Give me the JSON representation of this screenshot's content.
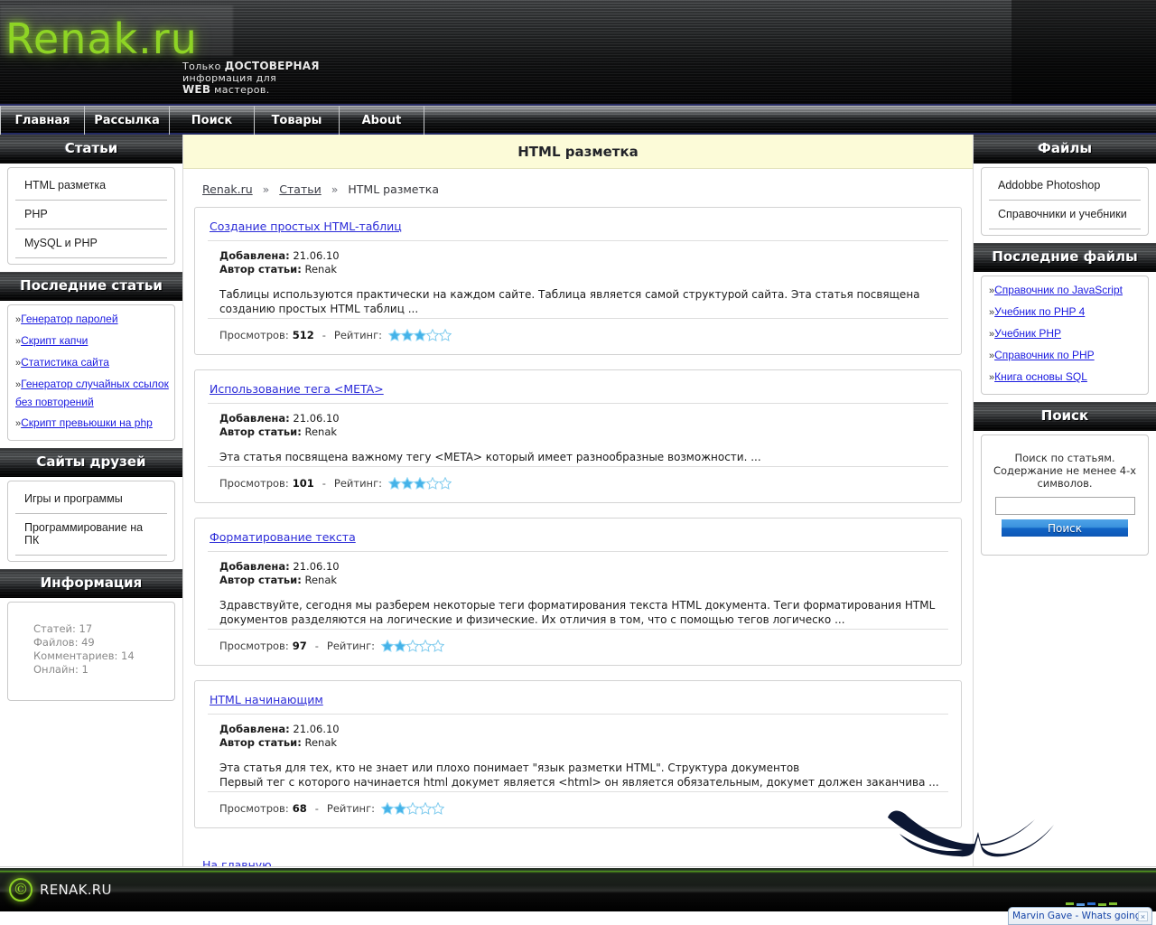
{
  "site": {
    "logo": "Renak.ru",
    "slogan_line1_plain": "Только ",
    "slogan_line1_bold": "ДОСТОВЕРНАЯ",
    "slogan_line2": "информация для",
    "slogan_line3_bold": "WEB",
    "slogan_line3_plain": " мастеров.",
    "accent_green": "#8ed425",
    "accent_blue": "#2c2cd8",
    "title_bg": "#fcfbd8"
  },
  "nav": {
    "items": [
      {
        "label": "Главная"
      },
      {
        "label": "Рассылка"
      },
      {
        "label": "Поиск"
      },
      {
        "label": "Товары"
      },
      {
        "label": "About"
      }
    ]
  },
  "left_sidebar": {
    "articles": {
      "title": "Статьи",
      "items": [
        {
          "label": "HTML разметка"
        },
        {
          "label": "PHP"
        },
        {
          "label": "MySQL и PHP"
        }
      ]
    },
    "latest_articles": {
      "title": "Последние статьи",
      "bullet": "»",
      "items": [
        {
          "label": "Генератор паролей"
        },
        {
          "label": "Скрипт капчи"
        },
        {
          "label": "Статистика сайта"
        },
        {
          "label": "Генератор случайных ссылок без повторений"
        },
        {
          "label": "Скрипт превьюшки на php"
        }
      ]
    },
    "friends": {
      "title": "Сайты друзей",
      "items": [
        {
          "label": "Игры и программы"
        },
        {
          "label": "Программирование на ПК"
        }
      ]
    },
    "information": {
      "title": "Информация",
      "lines": [
        "Статей: 17",
        "Файлов: 49",
        "Комментариев: 14",
        "Онлайн: 1"
      ]
    }
  },
  "right_sidebar": {
    "files": {
      "title": "Файлы",
      "items": [
        {
          "label": "Addobbe Photoshop"
        },
        {
          "label": "Справочники и учебники"
        }
      ]
    },
    "latest_files": {
      "title": "Последние файлы",
      "bullet": "»",
      "items": [
        {
          "label": "Справочник по JavaScript"
        },
        {
          "label": "Учебник по PHP 4"
        },
        {
          "label": "Учебник PHP"
        },
        {
          "label": "Справочник по PHP"
        },
        {
          "label": "Книга основы SQL"
        }
      ]
    },
    "search": {
      "title": "Поиск",
      "hint_line1": "Поиск по статьям.",
      "hint_line2": "Содержание не менее 4-х",
      "hint_line3": "символов.",
      "input_value": "",
      "input_placeholder": "",
      "button_label": "Поиск"
    }
  },
  "main": {
    "page_title": "HTML разметка",
    "breadcrumb": {
      "items": [
        "Renak.ru",
        "Статьи",
        "HTML разметка"
      ],
      "separator": "»"
    },
    "labels": {
      "added": "Добавлена:",
      "author": "Автор статьи:",
      "views": "Просмотров:",
      "rating": "Рейтинг:",
      "dash": "-"
    },
    "articles": [
      {
        "title": "Создание простых HTML-таблиц",
        "date": "21.06.10",
        "author": "Renak",
        "description": "Таблицы используются практически на каждом сайте. Таблица является самой структурой сайта. Эта статья посвящена созданию простых HTML таблиц ...",
        "views": "512",
        "rating": 3,
        "rating_max": 5
      },
      {
        "title": "Использование тега <META>",
        "date": "21.06.10",
        "author": "Renak",
        "description": "Эта статья посвящена важному тегу <META> который имеет разнообразные возможности. ...",
        "views": "101",
        "rating": 3,
        "rating_max": 5
      },
      {
        "title": "Форматирование текста",
        "date": "21.06.10",
        "author": "Renak",
        "description": "Здравствуйте, сегодня мы разберем некоторые теги форматирования текста HTML документа. Теги форматирования HTML документов разделяются на логические и физические. Их отличия в том, что с помощью тегов логическо ...",
        "views": "97",
        "rating": 2,
        "rating_max": 5
      },
      {
        "title": "HTML начинающим",
        "date": "21.06.10",
        "author": "Renak",
        "description": "Эта статья для тех, кто не знает или плохо понимает \"язык разметки HTML\". Структура документов\nПервый тег с которого начинается html докумет является <html> он является обязательным, докумет должен заканчива ...",
        "views": "68",
        "rating": 2,
        "rating_max": 5
      }
    ],
    "home_link": "На главную"
  },
  "footer": {
    "copyright_glyph": "©",
    "site_name": "RENAK.RU"
  },
  "player": {
    "track_title": "Marvin Gave - Whats going on",
    "close_label": "×"
  }
}
